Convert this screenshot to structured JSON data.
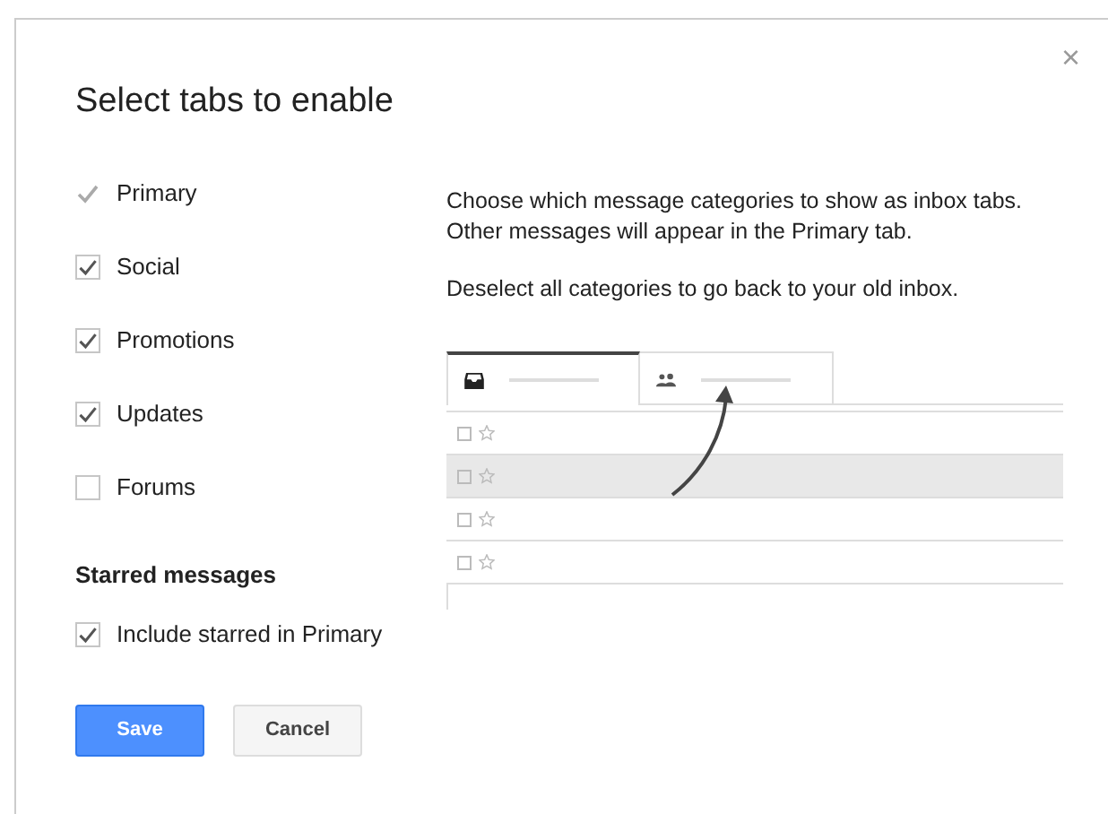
{
  "dialog": {
    "title": "Select tabs to enable",
    "close": "×"
  },
  "categories": [
    {
      "label": "Primary",
      "checked": true,
      "disabled": true
    },
    {
      "label": "Social",
      "checked": true,
      "disabled": false
    },
    {
      "label": "Promotions",
      "checked": true,
      "disabled": false
    },
    {
      "label": "Updates",
      "checked": true,
      "disabled": false
    },
    {
      "label": "Forums",
      "checked": false,
      "disabled": false
    }
  ],
  "starred": {
    "heading": "Starred messages",
    "option": {
      "label": "Include starred in Primary",
      "checked": true
    }
  },
  "description": [
    "Choose which message categories to show as inbox tabs.\nOther messages will appear in the Primary tab.",
    "Deselect all categories to go back to your old inbox."
  ],
  "preview": {
    "tabs": [
      {
        "selected": true
      },
      {
        "selected": false
      }
    ],
    "rows": [
      {
        "highlighted": false
      },
      {
        "highlighted": true
      },
      {
        "highlighted": false
      },
      {
        "highlighted": false
      }
    ]
  },
  "buttons": [
    {
      "label": "Save",
      "kind": "primary"
    },
    {
      "label": "Cancel",
      "kind": "secondary"
    }
  ]
}
